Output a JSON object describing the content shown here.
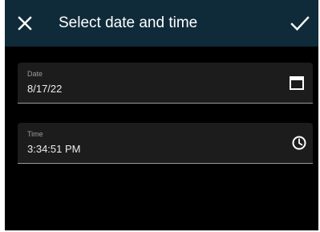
{
  "appbar": {
    "title": "Select date and time",
    "close_icon": "close-icon",
    "confirm_icon": "check-icon",
    "background_color": "#0f2b3a"
  },
  "form": {
    "date": {
      "label": "Date",
      "value": "8/17/22",
      "icon": "calendar-icon"
    },
    "time": {
      "label": "Time",
      "value": "3:34:51 PM",
      "icon": "clock-icon"
    }
  },
  "colors": {
    "page_background": "#000000",
    "field_background": "#1c1c1c",
    "label_text": "#9d9d9d",
    "value_text": "#ececec"
  }
}
